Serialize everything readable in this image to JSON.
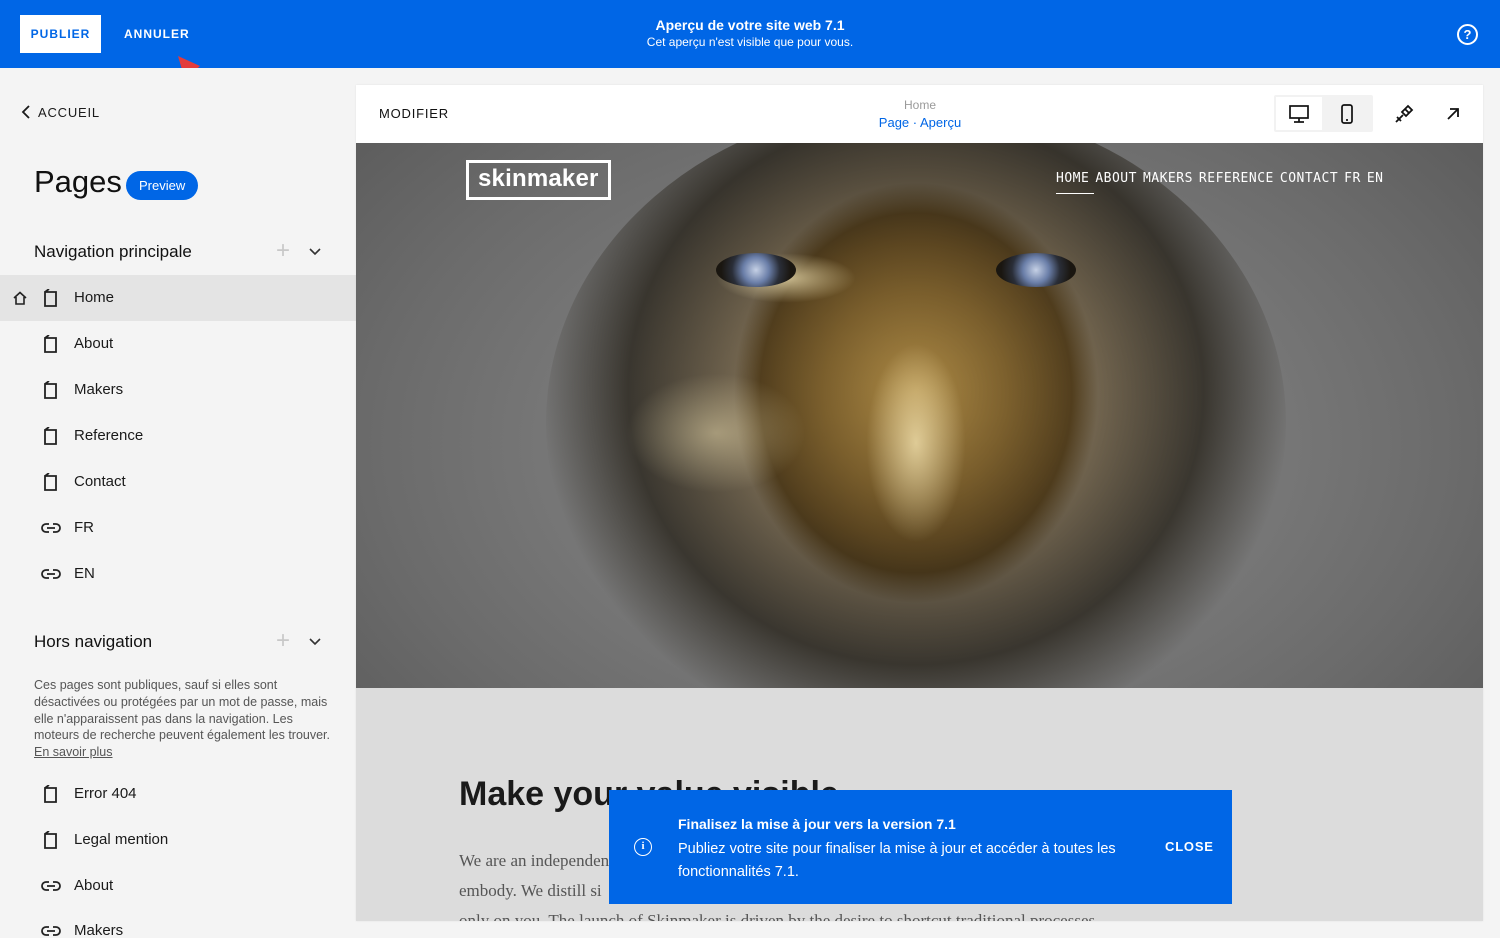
{
  "topbar": {
    "publish_label": "PUBLIER",
    "cancel_label": "ANNULER",
    "title": "Aperçu de votre site web 7.1",
    "subtitle": "Cet aperçu n'est visible que pour vous.",
    "help_icon": "question-circle-icon",
    "accent_color": "#0066e6"
  },
  "sidebar": {
    "back_label": "ACCUEIL",
    "title": "Pages",
    "badge": "Preview",
    "main_nav": {
      "title": "Navigation principale",
      "items": [
        {
          "label": "Home",
          "icon": "page-icon",
          "active": true
        },
        {
          "label": "About",
          "icon": "page-icon"
        },
        {
          "label": "Makers",
          "icon": "page-icon"
        },
        {
          "label": "Reference",
          "icon": "page-icon"
        },
        {
          "label": "Contact",
          "icon": "page-icon"
        },
        {
          "label": "FR",
          "icon": "link-icon"
        },
        {
          "label": "EN",
          "icon": "link-icon"
        }
      ]
    },
    "not_linked": {
      "title": "Hors navigation",
      "description": "Ces pages sont publiques, sauf si elles sont désactivées ou protégées par un mot de passe, mais elle n'apparaissent pas dans la navigation. Les moteurs de recherche peuvent également les trouver.",
      "learn_more": "En savoir plus",
      "items": [
        {
          "label": "Error 404",
          "icon": "page-icon"
        },
        {
          "label": "Legal mention",
          "icon": "page-icon"
        },
        {
          "label": "About",
          "icon": "link-icon"
        },
        {
          "label": "Makers",
          "icon": "link-icon"
        }
      ]
    }
  },
  "preview": {
    "modify_label": "MODIFIER",
    "page_name": "Home",
    "breadcrumb": "Page · Aperçu",
    "site": {
      "logo": "skinmaker",
      "nav": [
        "HOME",
        "ABOUT",
        "MAKERS",
        "REFERENCE",
        "CONTACT",
        "FR",
        "EN"
      ],
      "heading": "Make your value visible",
      "body_lines": [
        "We are an independent",
        "embody. We distill si",
        "only on you. The launch of Skinmaker is driven by the desire to shortcut traditional processes"
      ]
    }
  },
  "toast": {
    "title": "Finalisez la mise à jour vers la version 7.1",
    "body": "Publiez votre site pour finaliser la mise à jour et accéder à toutes les fonctionnalités 7.1.",
    "close_label": "CLOSE",
    "icon": "info-icon"
  }
}
